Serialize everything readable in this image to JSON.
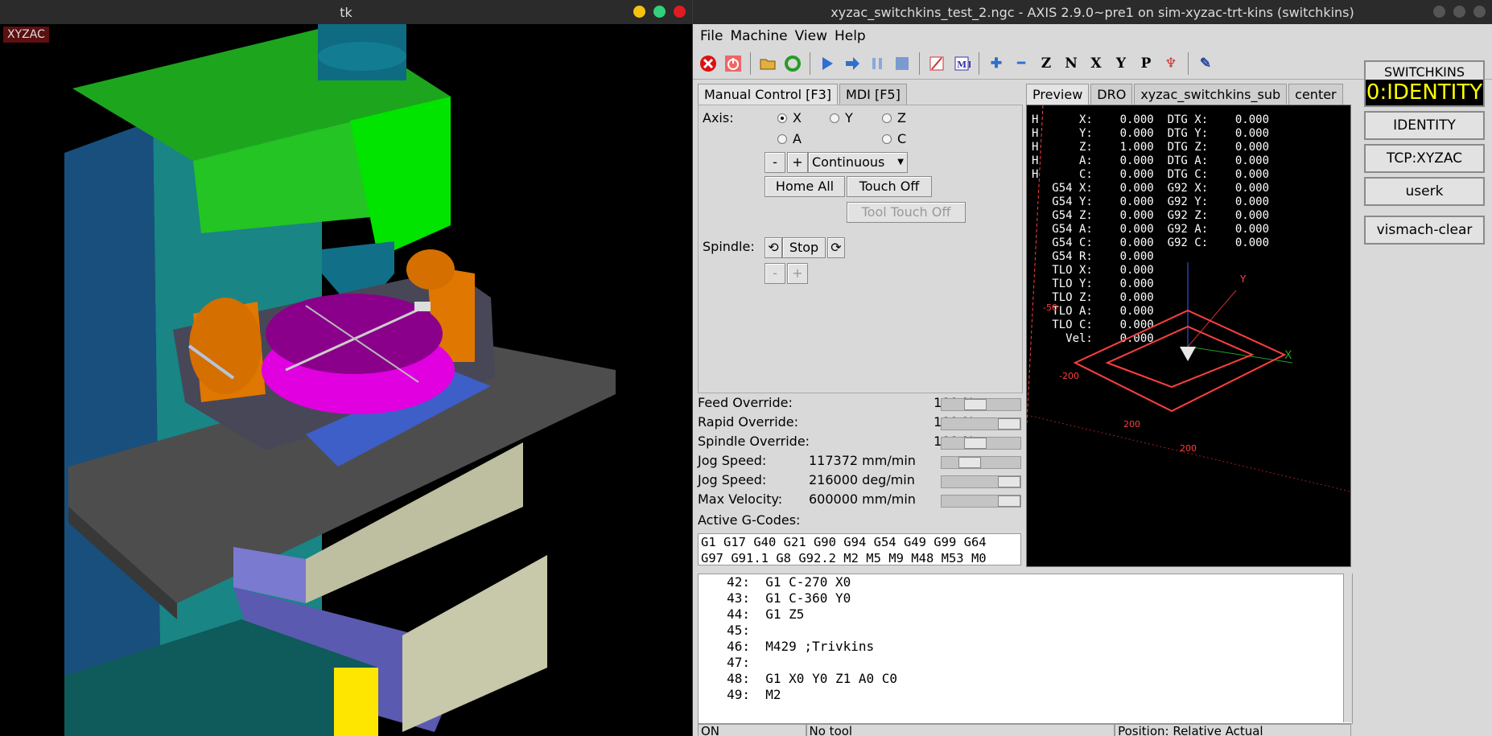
{
  "left_window": {
    "title": "tk",
    "canvas_tag": "XYZAC"
  },
  "axis_window": {
    "title": "xyzac_switchkins_test_2.ngc - AXIS 2.9.0~pre1 on sim-xyzac-trt-kins (switchkins)",
    "menu": [
      "File",
      "Machine",
      "View",
      "Help"
    ],
    "toolbar_icons": [
      "estop-icon",
      "power-icon",
      "open-file-icon",
      "reload-icon",
      "run-icon",
      "step-icon",
      "pause-icon",
      "stop-icon",
      "block-delete-icon",
      "optional-stop-icon",
      "zoom-in-icon",
      "zoom-out-icon",
      "view-z-icon",
      "view-z2-icon",
      "view-x-icon",
      "view-y-icon",
      "view-p-icon",
      "rotate-icon",
      "clear-plot-icon"
    ],
    "left_tabs": [
      "Manual Control [F3]",
      "MDI [F5]"
    ],
    "manual": {
      "axis_label": "Axis:",
      "axes": [
        "X",
        "Y",
        "Z",
        "A",
        "C"
      ],
      "selected_axis": "X",
      "minus": "-",
      "plus": "+",
      "jog_mode": "Continuous",
      "home_all": "Home All",
      "touch_off": "Touch Off",
      "tool_touch_off": "Tool Touch Off",
      "spindle_label": "Spindle:",
      "spindle_stop": "Stop",
      "spindle_minus": "-",
      "spindle_plus": "+"
    },
    "overrides": [
      {
        "label": "Feed Override:",
        "value": "100 %",
        "level": 0.4
      },
      {
        "label": "Rapid Override:",
        "value": "100 %",
        "level": 1.0
      },
      {
        "label": "Spindle Override:",
        "value": "100 %",
        "level": 0.4
      },
      {
        "label": "Jog Speed:",
        "value": "117372 mm/min",
        "level": 0.3
      },
      {
        "label": "Jog Speed:",
        "value": "216000 deg/min",
        "level": 1.0
      },
      {
        "label": "Max Velocity:",
        "value": "600000 mm/min",
        "level": 1.0
      }
    ],
    "active_gcodes_label": "Active G-Codes:",
    "active_gcodes": [
      "G1 G17 G40 G21 G90 G94 G54 G49 G99 G64",
      "G97 G91.1 G8 G92.2 M2 M5 M9 M48 M53 M0"
    ],
    "right_tabs": [
      "Preview",
      "DRO",
      "xyzac_switchkins_sub",
      "center"
    ],
    "dro_lines": [
      "H      X:    0.000  DTG X:    0.000",
      "H      Y:    0.000  DTG Y:    0.000",
      "H      Z:    1.000  DTG Z:    0.000",
      "H      A:    0.000  DTG A:    0.000",
      "H      C:    0.000  DTG C:    0.000",
      "   G54 X:    0.000  G92 X:    0.000",
      "   G54 Y:    0.000  G92 Y:    0.000",
      "   G54 Z:    0.000  G92 Z:    0.000",
      "   G54 A:    0.000  G92 A:    0.000",
      "   G54 C:    0.000  G92 C:    0.000",
      "   G54 R:    0.000",
      "   TLO X:    0.000",
      "   TLO Y:    0.000",
      "   TLO Z:    0.000",
      "   TLO A:    0.000",
      "   TLO C:    0.000",
      "     Vel:    0.000"
    ],
    "preview_labels": [
      "-200",
      "200",
      "200",
      "-200",
      "-50"
    ],
    "code_lines": [
      {
        "num": "42:",
        "text": "G1 C-270 X0"
      },
      {
        "num": "43:",
        "text": "G1 C-360 Y0"
      },
      {
        "num": "44:",
        "text": "G1 Z5"
      },
      {
        "num": "45:",
        "text": ""
      },
      {
        "num": "46:",
        "text": "M429 ;Trivkins"
      },
      {
        "num": "47:",
        "text": ""
      },
      {
        "num": "48:",
        "text": "G1 X0 Y0 Z1 A0 C0"
      },
      {
        "num": "49:",
        "text": "M2"
      }
    ],
    "status": {
      "state": "ON",
      "tool": "No tool",
      "position": "Position: Relative Actual"
    },
    "right_panel": {
      "switchkins": "SWITCHKINS",
      "mode": "0:IDENTITY",
      "buttons": [
        "IDENTITY",
        "TCP:XYZAC",
        "userk"
      ],
      "vismach_clear": "vismach-clear"
    }
  },
  "colors": {
    "accent_yellow": "#ffff00",
    "preview_bg": "#000000",
    "path_red": "#ff4040"
  }
}
